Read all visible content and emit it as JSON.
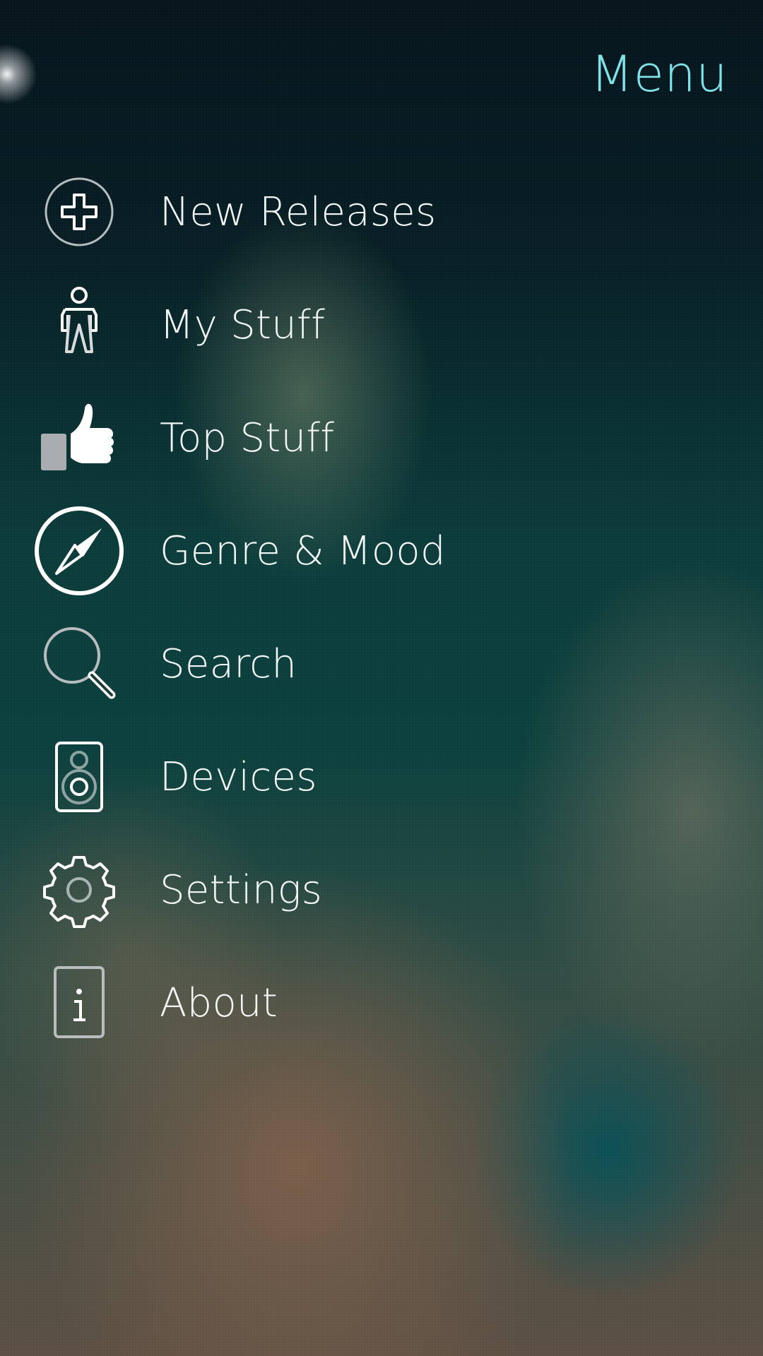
{
  "app": {
    "title": "Menu",
    "accent_color": "#7fe3ea"
  },
  "menu": {
    "items": [
      {
        "label": "New Releases",
        "icon": "plus-circle-icon"
      },
      {
        "label": "My Stuff",
        "icon": "person-icon"
      },
      {
        "label": "Top Stuff",
        "icon": "thumbs-up-icon"
      },
      {
        "label": "Genre & Mood",
        "icon": "compass-icon"
      },
      {
        "label": "Search",
        "icon": "search-icon"
      },
      {
        "label": "Devices",
        "icon": "speaker-icon"
      },
      {
        "label": "Settings",
        "icon": "gear-icon"
      },
      {
        "label": "About",
        "icon": "info-icon"
      }
    ]
  }
}
